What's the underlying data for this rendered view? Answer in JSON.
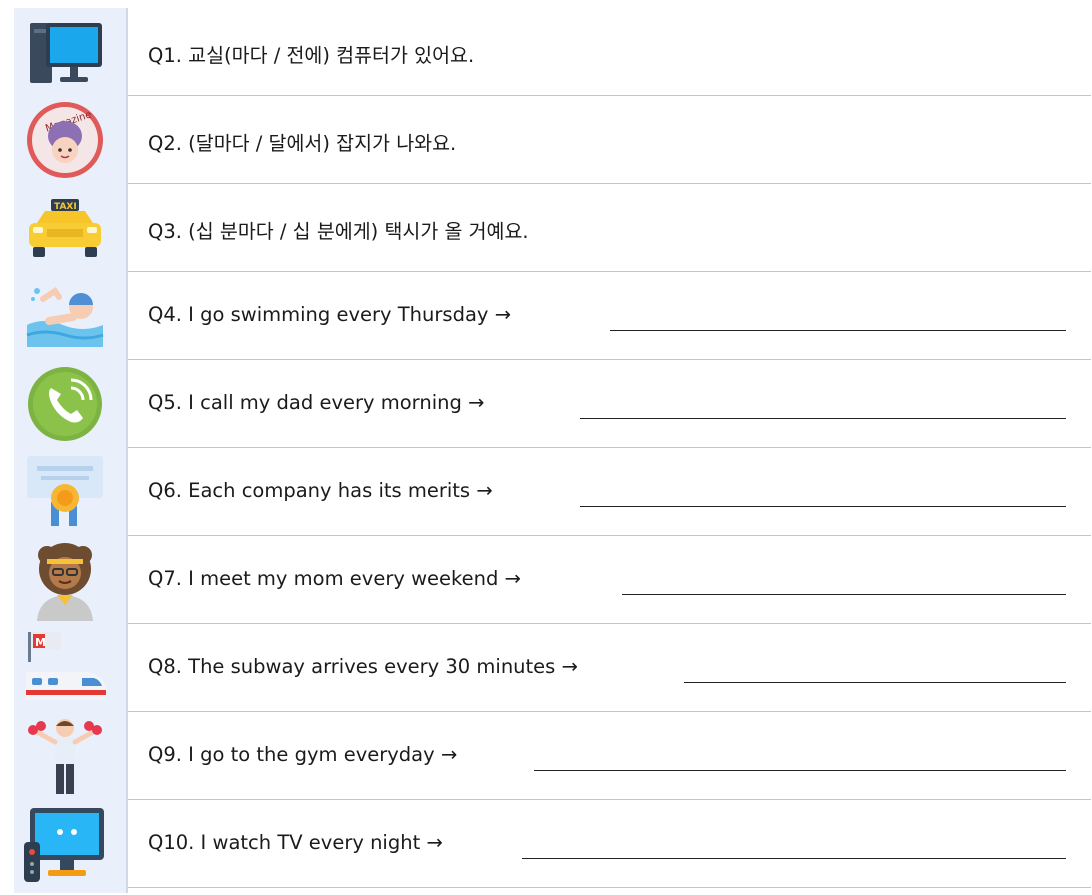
{
  "questions": [
    {
      "text": "Q1. 교실(마다 / 전에) 컴퓨터가 있어요.",
      "icon": "computer-icon"
    },
    {
      "text": "Q2. (달마다 / 달에서) 잡지가 나와요.",
      "icon": "magazine-icon",
      "icon_text": "Magazine"
    },
    {
      "text": "Q3. (십 분마다 / 십 분에게) 택시가 올 거예요.",
      "icon": "taxi-icon",
      "icon_text": "TAXI"
    },
    {
      "text": "Q4. I go swimming every Thursday →",
      "icon": "swimmer-icon"
    },
    {
      "text": "Q5. I call my dad every morning →",
      "icon": "phone-call-icon"
    },
    {
      "text": "Q6. Each company has its merits →",
      "icon": "certificate-icon"
    },
    {
      "text": "Q7. I meet my mom every weekend →",
      "icon": "woman-avatar-icon"
    },
    {
      "text": "Q8. The subway arrives every 30 minutes →",
      "icon": "subway-train-icon",
      "icon_text": "M"
    },
    {
      "text": "Q9. I go to the gym everyday →",
      "icon": "dumbbell-man-icon"
    },
    {
      "text": "Q10. I watch TV every night →",
      "icon": "television-icon"
    }
  ]
}
